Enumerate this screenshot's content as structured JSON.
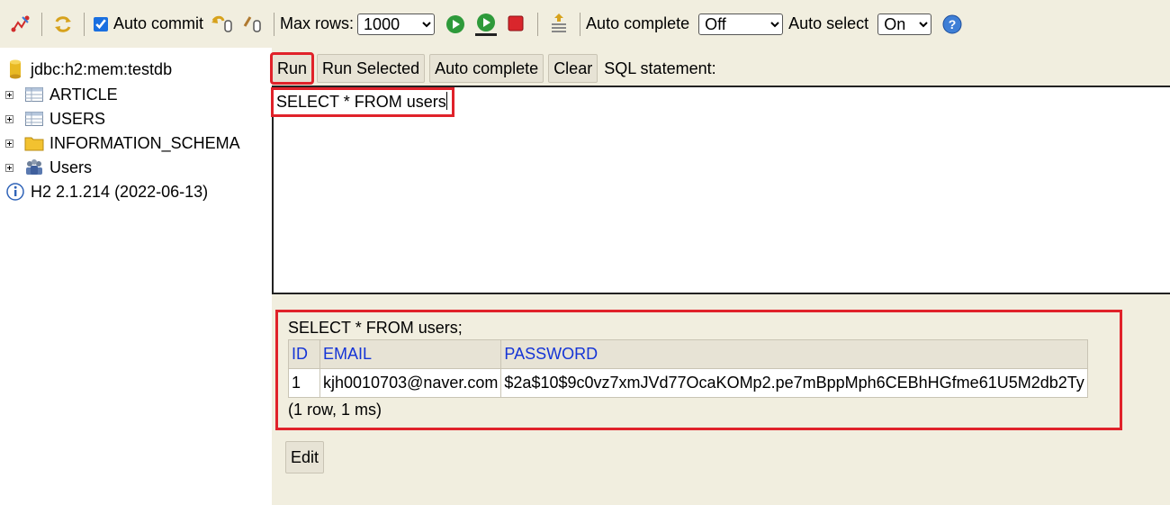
{
  "toolbar": {
    "auto_commit_label": "Auto commit",
    "auto_commit_checked": true,
    "max_rows_label": "Max rows:",
    "max_rows_value": "1000",
    "auto_complete_label": "Auto complete",
    "auto_complete_value": "Off",
    "auto_select_label": "Auto select",
    "auto_select_value": "On"
  },
  "tree": {
    "connection": "jdbc:h2:mem:testdb",
    "items": [
      {
        "label": "ARTICLE",
        "icon": "table-icon"
      },
      {
        "label": "USERS",
        "icon": "table-icon"
      },
      {
        "label": "INFORMATION_SCHEMA",
        "icon": "folder-icon"
      },
      {
        "label": "Users",
        "icon": "users-icon"
      }
    ],
    "version": "H2 2.1.214 (2022-06-13)"
  },
  "query_bar": {
    "run_label": "Run",
    "run_selected_label": "Run Selected",
    "auto_complete_label": "Auto complete",
    "clear_label": "Clear",
    "sql_statement_label": "SQL statement:"
  },
  "editor": {
    "text": "SELECT * FROM users"
  },
  "result": {
    "statement": "SELECT * FROM users;",
    "columns": [
      "ID",
      "EMAIL",
      "PASSWORD"
    ],
    "rows": [
      [
        "1",
        "kjh0010703@naver.com",
        "$2a$10$9c0vz7xmJVd77OcaKOMp2.pe7mBppMph6CEBhHGfme61U5M2db2Ty"
      ]
    ],
    "count": "(1 row, 1 ms)"
  },
  "edit_label": "Edit",
  "colors": {
    "panel_bg": "#f1eedf",
    "highlight_red": "#e0222a",
    "header_link": "#1434d6"
  }
}
